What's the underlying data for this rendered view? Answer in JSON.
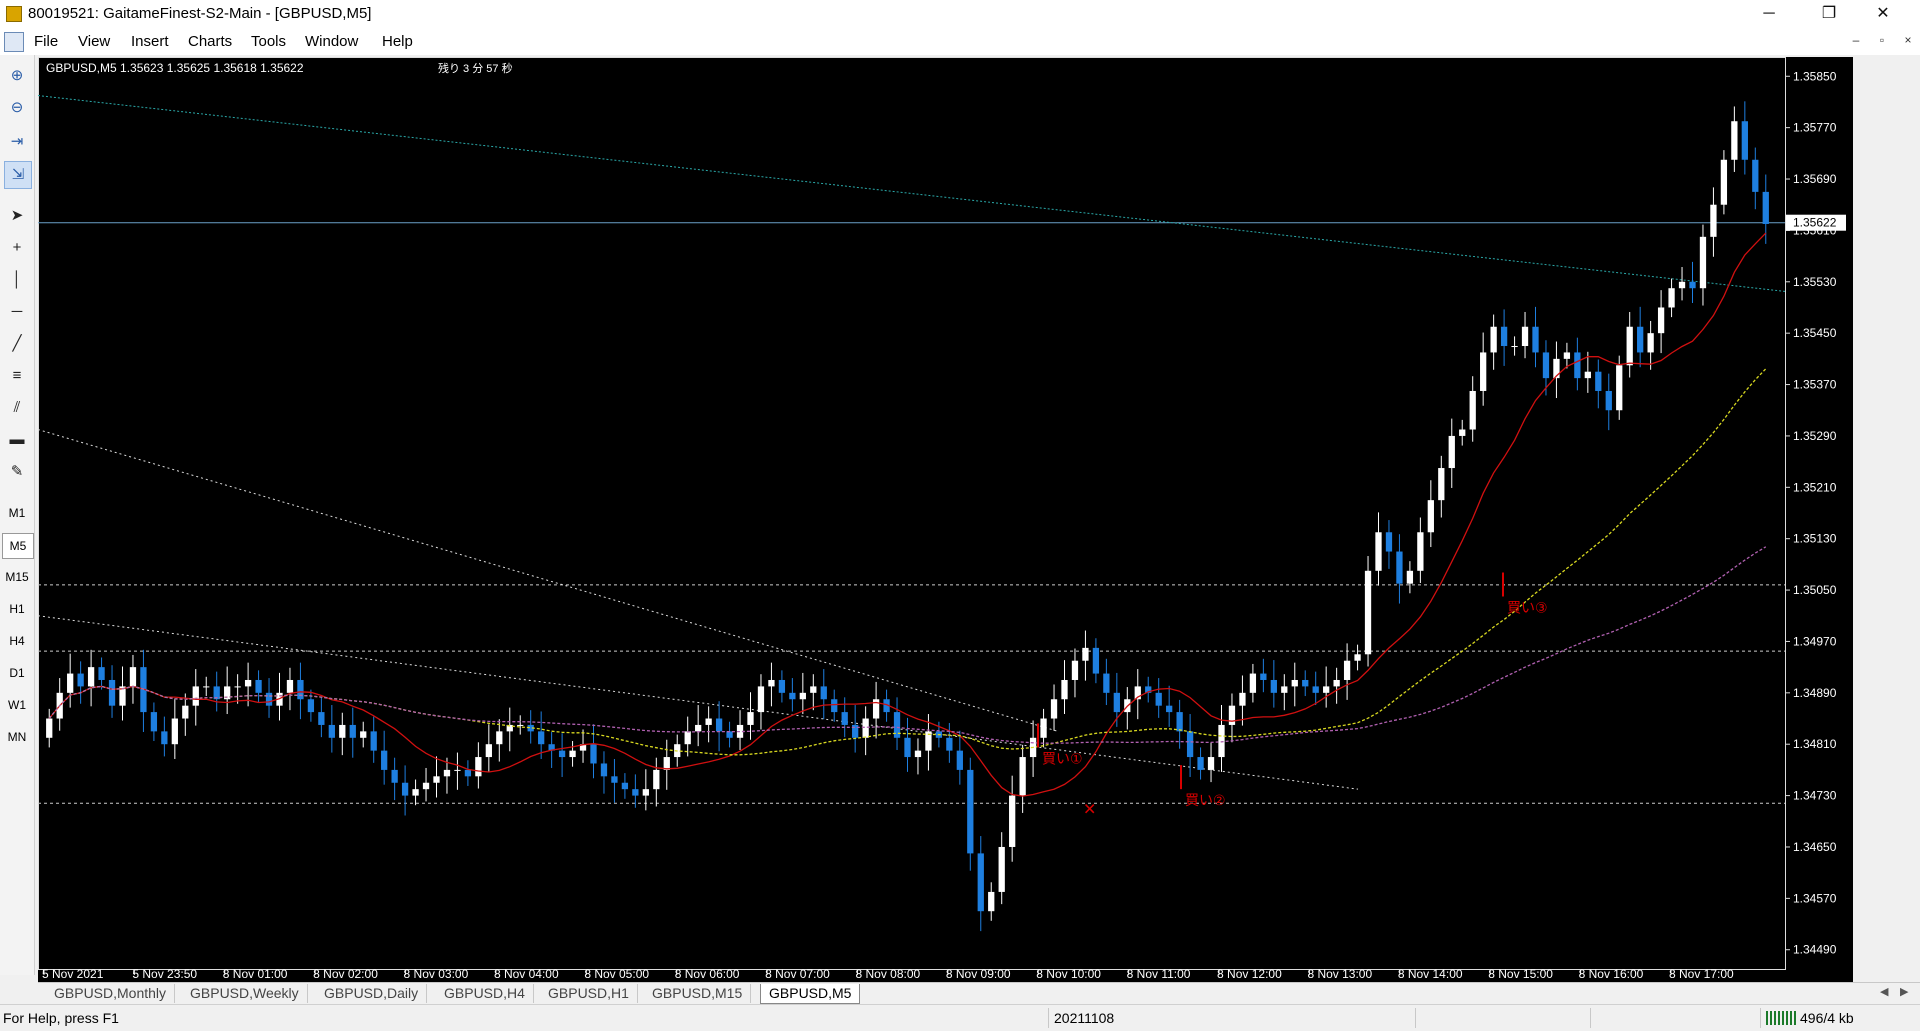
{
  "window": {
    "title": "80019521: GaitameFinest-S2-Main - [GBPUSD,M5]",
    "minimize_glyph": "─",
    "restore_glyph": "❐",
    "close_glyph": "✕"
  },
  "menu": {
    "items": [
      "File",
      "View",
      "Insert",
      "Charts",
      "Tools",
      "Window",
      "Help"
    ],
    "mdi_controls": [
      "–",
      "▫",
      "×"
    ]
  },
  "toolbar": {
    "icons": [
      "zoom-in-icon",
      "zoom-out-icon",
      "chart-shift-icon",
      "autoscroll-icon",
      "cursor-icon",
      "crosshair-icon",
      "vertical-line-icon",
      "horizontal-line-icon",
      "trendline-icon",
      "fibonacci-icon",
      "channel-icon",
      "rectangle-icon",
      "objects-icon"
    ],
    "timeframes": [
      "M1",
      "M5",
      "M15",
      "H1",
      "H4",
      "D1",
      "W1",
      "MN"
    ],
    "selected_timeframe": "M5"
  },
  "chart": {
    "symbol_header": "GBPUSD,M5  1.35623 1.35625 1.35618 1.35622",
    "remaining_time": "残り 3 分 57 秒",
    "current_price_label": "1.35622",
    "price_axis_labels": [
      "1.35850",
      "1.35770",
      "1.35690",
      "1.35610",
      "1.35530",
      "1.35450",
      "1.35370",
      "1.35290",
      "1.35210",
      "1.35130",
      "1.35050",
      "1.34970",
      "1.34890",
      "1.34810",
      "1.34730",
      "1.34650",
      "1.34570",
      "1.34490"
    ],
    "time_axis_labels": [
      "5 Nov 2021",
      "5 Nov 23:50",
      "8 Nov 01:00",
      "8 Nov 02:00",
      "8 Nov 03:00",
      "8 Nov 04:00",
      "8 Nov 05:00",
      "8 Nov 06:00",
      "8 Nov 07:00",
      "8 Nov 08:00",
      "8 Nov 09:00",
      "8 Nov 10:00",
      "8 Nov 11:00",
      "8 Nov 12:00",
      "8 Nov 13:00",
      "8 Nov 14:00",
      "8 Nov 15:00",
      "8 Nov 16:00",
      "8 Nov 17:00"
    ],
    "annotations": [
      "買い①",
      "買い②",
      "買い③"
    ],
    "colors": {
      "background": "#000000",
      "bull_candle": "#ffffff",
      "bear_candle": "#1e7fe0",
      "ma_fast": "#d01010",
      "ma_mid": "#d8d820",
      "ma_slow": "#b060b0",
      "long_trend": "#2aa8a8",
      "annotation": "#d80000"
    }
  },
  "chart_data": {
    "type": "candlestick",
    "symbol": "GBPUSD",
    "timeframe": "M5",
    "ylim": [
      1.3446,
      1.3588
    ],
    "y_ticks": [
      1.3585,
      1.3577,
      1.3569,
      1.3561,
      1.3553,
      1.3545,
      1.3537,
      1.3529,
      1.3521,
      1.3513,
      1.3505,
      1.3497,
      1.3489,
      1.3481,
      1.3473,
      1.3465,
      1.3457,
      1.3449
    ],
    "current_price": 1.35622,
    "horizontal_levels": [
      1.35622,
      1.35058,
      1.34955,
      1.34718
    ],
    "close_series": [
      1.3485,
      1.3489,
      1.3492,
      1.349,
      1.3493,
      1.3491,
      1.3487,
      1.349,
      1.3493,
      1.3486,
      1.3483,
      1.3481,
      1.3485,
      1.3487,
      1.349,
      1.349,
      1.3488,
      1.349,
      1.349,
      1.3491,
      1.3489,
      1.3487,
      1.3489,
      1.3491,
      1.3488,
      1.3486,
      1.3484,
      1.3482,
      1.3484,
      1.3482,
      1.3483,
      1.348,
      1.3477,
      1.3475,
      1.3473,
      1.3474,
      1.3475,
      1.3476,
      1.3477,
      1.3477,
      1.3476,
      1.3479,
      1.3481,
      1.3483,
      1.3484,
      1.3484,
      1.3483,
      1.3481,
      1.348,
      1.3479,
      1.348,
      1.3481,
      1.3478,
      1.3476,
      1.3475,
      1.3474,
      1.3473,
      1.3474,
      1.3477,
      1.3479,
      1.3481,
      1.3483,
      1.3484,
      1.3485,
      1.3483,
      1.3482,
      1.3484,
      1.3486,
      1.349,
      1.3491,
      1.3489,
      1.3488,
      1.3489,
      1.349,
      1.3488,
      1.3486,
      1.3484,
      1.3482,
      1.3485,
      1.3488,
      1.3486,
      1.3482,
      1.3479,
      1.348,
      1.3483,
      1.3482,
      1.348,
      1.3477,
      1.3464,
      1.3455,
      1.3458,
      1.3465,
      1.3473,
      1.3479,
      1.3482,
      1.3485,
      1.3488,
      1.3491,
      1.3494,
      1.3496,
      1.3492,
      1.3489,
      1.3486,
      1.3488,
      1.349,
      1.3489,
      1.3487,
      1.3486,
      1.3483,
      1.3479,
      1.3477,
      1.3479,
      1.3484,
      1.3487,
      1.3489,
      1.3492,
      1.3491,
      1.3489,
      1.349,
      1.3491,
      1.349,
      1.3489,
      1.349,
      1.3491,
      1.3494,
      1.3495,
      1.3508,
      1.3514,
      1.3511,
      1.3506,
      1.3508,
      1.3514,
      1.3519,
      1.3524,
      1.3529,
      1.353,
      1.3536,
      1.3542,
      1.3546,
      1.3543,
      1.3543,
      1.3546,
      1.3542,
      1.3538,
      1.3541,
      1.3542,
      1.3538,
      1.3539,
      1.3536,
      1.3533,
      1.354,
      1.3546,
      1.3542,
      1.3545,
      1.3549,
      1.3552,
      1.3553,
      1.3552,
      1.356,
      1.3565,
      1.3572,
      1.3578,
      1.3572,
      1.3567,
      1.3562
    ]
  }
}
